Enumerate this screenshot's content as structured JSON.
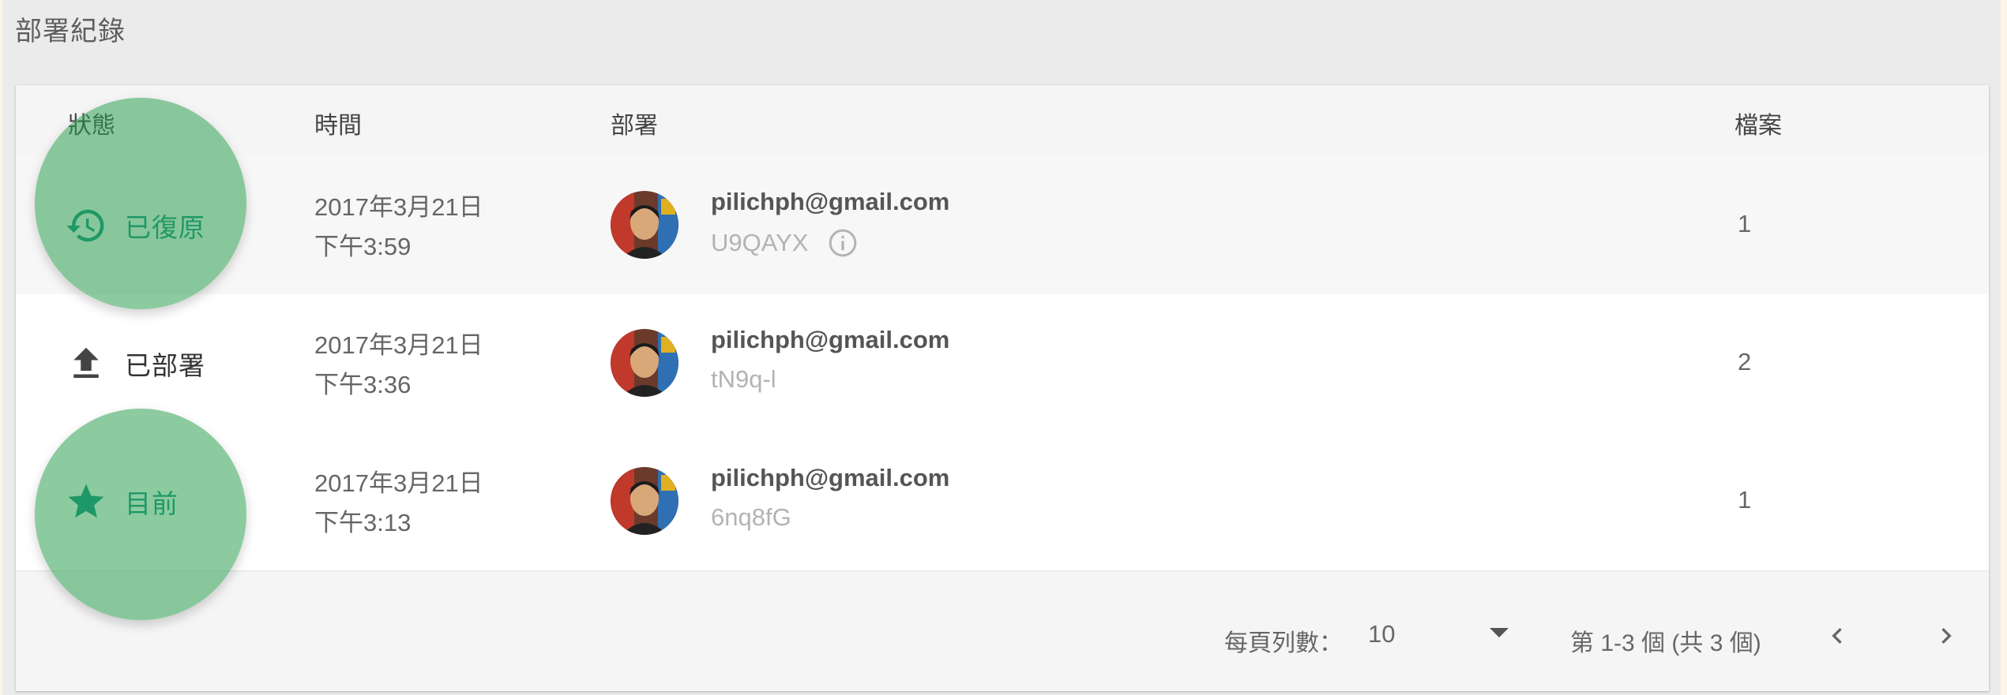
{
  "section_title": "部署紀錄",
  "table": {
    "headers": {
      "status": "狀態",
      "time": "時間",
      "deploy": "部署",
      "files": "檔案"
    },
    "rows": [
      {
        "status_icon": "history-icon",
        "status": "已復原",
        "date": "2017年3月21日",
        "time": "下午3:59",
        "email": "pilichph@gmail.com",
        "deploy_id": "U9QAYX",
        "has_info": true,
        "files": "1"
      },
      {
        "status_icon": "upload-icon",
        "status": "已部署",
        "date": "2017年3月21日",
        "time": "下午3:36",
        "email": "pilichph@gmail.com",
        "deploy_id": "tN9q-l",
        "has_info": false,
        "files": "2"
      },
      {
        "status_icon": "star-icon",
        "status": "目前",
        "date": "2017年3月21日",
        "time": "下午3:13",
        "email": "pilichph@gmail.com",
        "deploy_id": "6nq8fG",
        "has_info": false,
        "files": "1"
      }
    ]
  },
  "pagination": {
    "rows_per_page_label": "每頁列數：",
    "rows_per_page_value": "10",
    "range_text": "第 1-3 個 (共 3 個)"
  },
  "colors": {
    "accent_teal": "#0f8f83",
    "highlight_green": "#2ea050"
  }
}
